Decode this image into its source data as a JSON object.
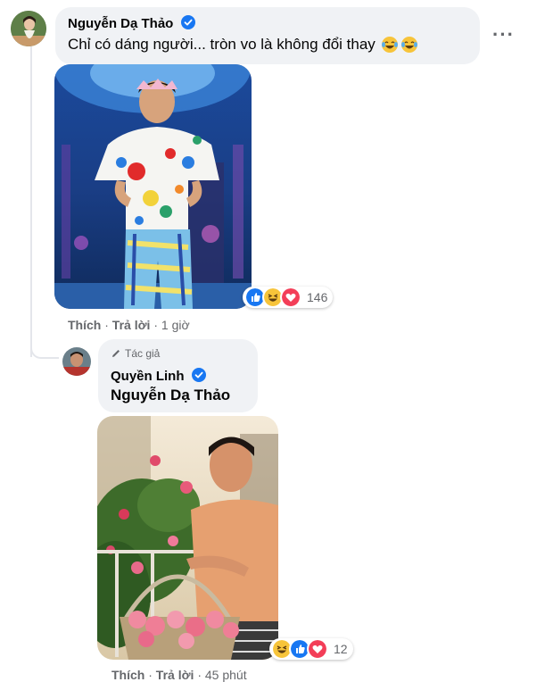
{
  "comment": {
    "author": "Nguyễn Dạ Thảo",
    "text": "Chỉ có dáng người... tròn vo là không đổi thay",
    "text_emojis": [
      "laugh-tears",
      "laugh-tears"
    ],
    "reactions": {
      "icons": [
        "like",
        "haha",
        "love"
      ],
      "count": "146"
    },
    "actions": {
      "like": "Thích",
      "reply": "Trả lời",
      "time": "1 giờ"
    }
  },
  "reply": {
    "badge": "Tác giả",
    "author": "Quyền Linh",
    "mention": "Nguyễn Dạ Thảo",
    "reactions": {
      "icons": [
        "haha",
        "like",
        "love"
      ],
      "count": "12"
    },
    "actions": {
      "like": "Thích",
      "reply": "Trả lời",
      "time": "45 phút"
    }
  },
  "colors": {
    "verified": "#1877f2",
    "bubble": "#f0f2f5",
    "meta": "#65676b"
  }
}
